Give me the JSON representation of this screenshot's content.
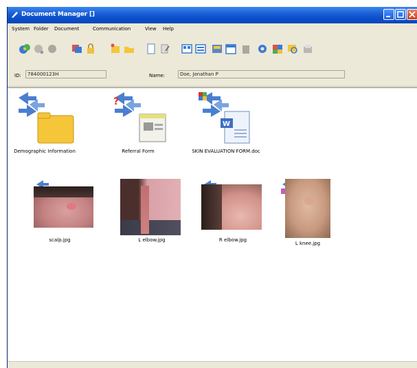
{
  "window": {
    "title": "Document Manager []"
  },
  "menubar": {
    "items": [
      "System",
      "Folder",
      "Document",
      "Communication",
      "View",
      "Help"
    ]
  },
  "toolbar": {
    "icons": [
      "refresh-icon",
      "back-icon",
      "stop-icon",
      "users-icon",
      "lock-icon",
      "new-folder-icon",
      "open-folder-icon",
      "new-document-icon",
      "edit-document-icon",
      "view-large-icon",
      "view-list-icon",
      "scan-icon",
      "calendar-icon",
      "printer-icon",
      "settings-icon",
      "chart-icon",
      "search-icon",
      "export-icon"
    ]
  },
  "patient": {
    "id_label": "ID:",
    "id_value": "784000123H",
    "name_label": "Name:",
    "name_value": "Doe, Jonathan P"
  },
  "documents": [
    {
      "label": "Demographic Information",
      "type": "folder"
    },
    {
      "label": "Referral Form",
      "type": "form"
    },
    {
      "label": "SKIN EVALUATION FORM.doc",
      "type": "word"
    }
  ],
  "images": [
    {
      "label": "scalp.jpg"
    },
    {
      "label": "L elbow.jpg"
    },
    {
      "label": "R elbow.jpg"
    },
    {
      "label": "L knee.jpg"
    }
  ],
  "colors": {
    "title_bar": "#0a4fc9",
    "window_bg": "#ece9d8",
    "folder": "#f5c53a"
  }
}
